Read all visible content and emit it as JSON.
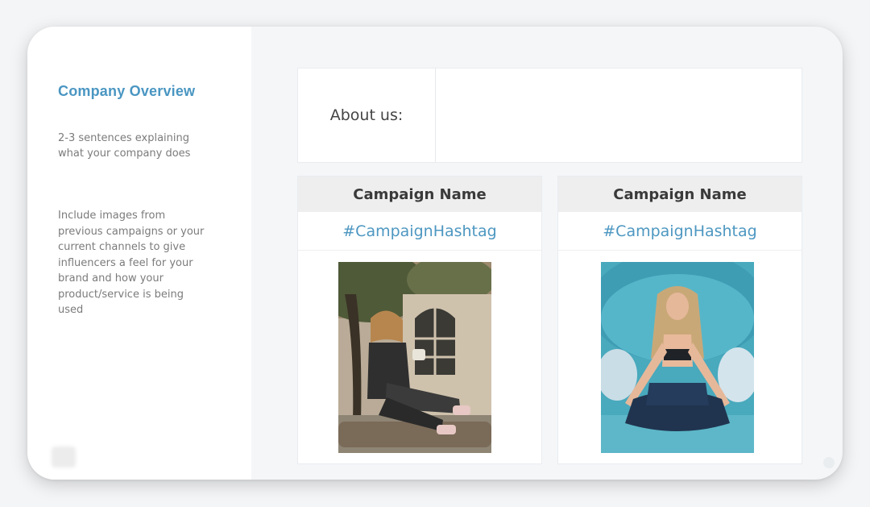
{
  "left_panel": {
    "title": "Company Overview",
    "description": "2-3 sentences explaining what your company does",
    "note": "Include images from previous campaigns or your current channels to give influencers a feel for your brand and how your product/service is being used"
  },
  "about": {
    "label": "About us:",
    "content": ""
  },
  "campaigns": [
    {
      "name": "Campaign Name",
      "hashtag": "#CampaignHashtag",
      "photo": "woman-sitting-on-log-photo"
    },
    {
      "name": "Campaign Name",
      "hashtag": "#CampaignHashtag",
      "photo": "woman-meditating-yoga-photo"
    }
  ],
  "colors": {
    "accent": "#4a96c2",
    "text_muted": "#7b7b7b",
    "card_header_bg": "#eeeeee"
  }
}
